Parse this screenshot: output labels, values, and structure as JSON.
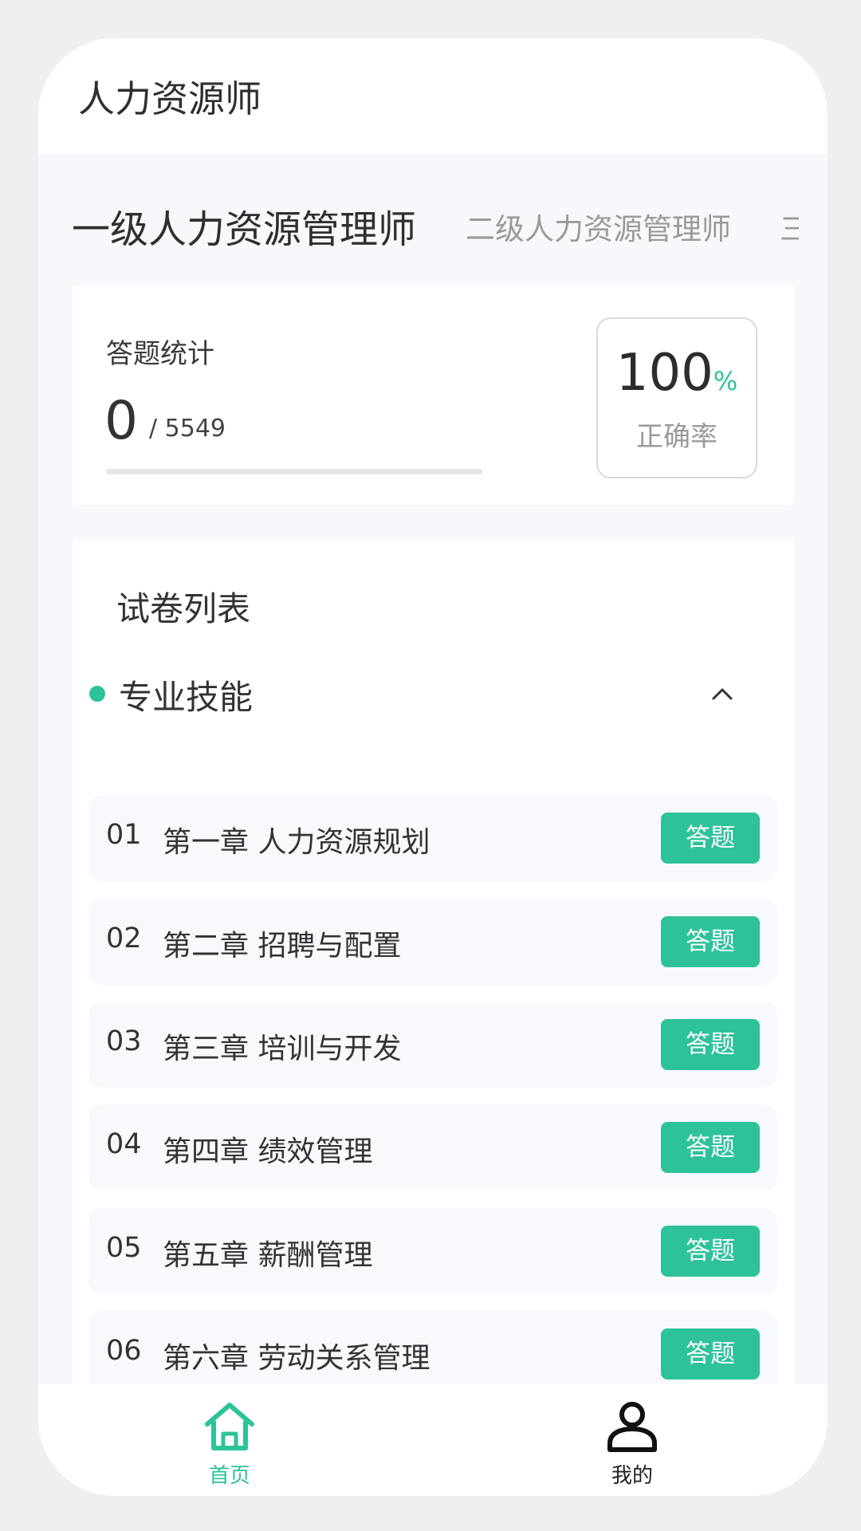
{
  "app": {
    "title": "人力资源师"
  },
  "tabs": [
    {
      "label": "一级人力资源管理师",
      "active": true
    },
    {
      "label": "二级人力资源管理师",
      "active": false
    },
    {
      "label": "三级人力资源管理师",
      "active": false
    }
  ],
  "stats": {
    "label": "答题统计",
    "answered": "0",
    "total": "/ 5549",
    "progress_fraction": 0,
    "accuracy_value": "100",
    "accuracy_unit": "%",
    "accuracy_label": "正确率"
  },
  "exam_list": {
    "title": "试卷列表",
    "section": "专业技能",
    "button_label": "答题",
    "chapters": [
      {
        "num": "01",
        "title": "第一章 人力资源规划"
      },
      {
        "num": "02",
        "title": "第二章 招聘与配置"
      },
      {
        "num": "03",
        "title": "第三章 培训与开发"
      },
      {
        "num": "04",
        "title": "第四章 绩效管理"
      },
      {
        "num": "05",
        "title": "第五章 薪酬管理"
      },
      {
        "num": "06",
        "title": "第六章 劳动关系管理"
      }
    ]
  },
  "nav": {
    "home": "首页",
    "me": "我的"
  },
  "colors": {
    "accent": "#2ec29a"
  },
  "icons": {
    "home": "home-icon",
    "me": "user-icon",
    "collapse": "chevron-up-icon"
  }
}
